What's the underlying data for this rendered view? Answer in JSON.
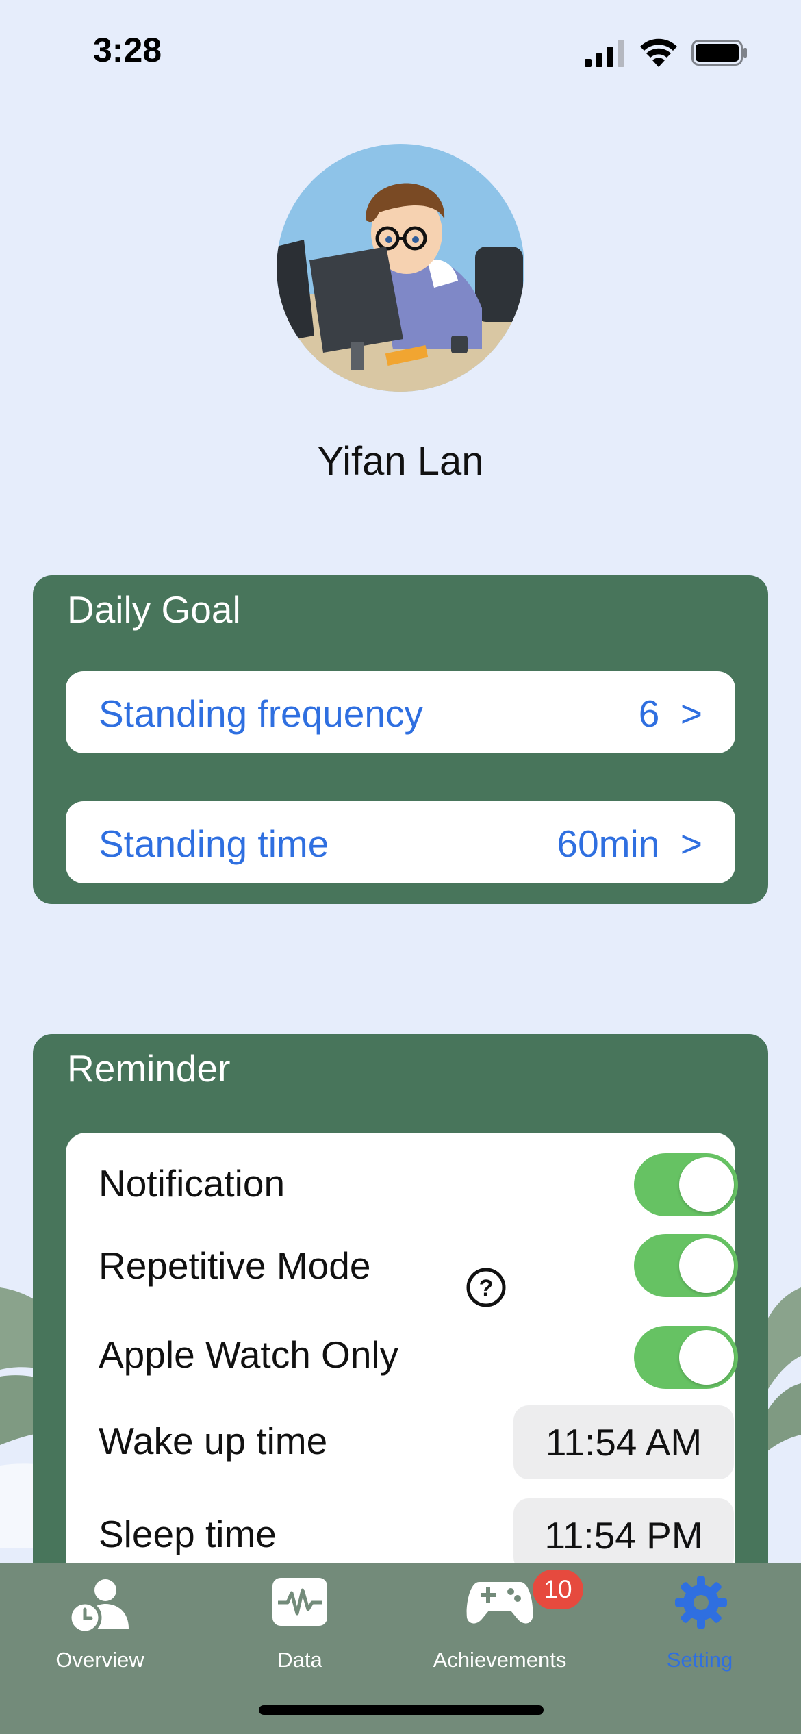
{
  "status_bar": {
    "time": "3:28"
  },
  "profile": {
    "name": "Yifan Lan"
  },
  "daily_goal": {
    "title": "Daily Goal",
    "items": [
      {
        "label": "Standing frequency",
        "value": "6",
        "chevron": ">"
      },
      {
        "label": "Standing time",
        "value": "60min",
        "chevron": ">"
      }
    ]
  },
  "reminder": {
    "title": "Reminder",
    "toggles": [
      {
        "label": "Notification",
        "on": true
      },
      {
        "label": "Repetitive Mode",
        "on": true,
        "icon": "question-circle-icon"
      },
      {
        "label": "Apple Watch Only",
        "on": true
      }
    ],
    "times": [
      {
        "label": "Wake up time",
        "value": "11:54 AM"
      },
      {
        "label": "Sleep time",
        "value": "11:54 PM"
      }
    ]
  },
  "tab_bar": {
    "tabs": [
      {
        "label": "Overview",
        "icon": "person-clock-icon"
      },
      {
        "label": "Data",
        "icon": "waveform-icon"
      },
      {
        "label": "Achievements",
        "icon": "gamecontroller-icon",
        "badge": "10"
      },
      {
        "label": "Setting",
        "icon": "gear-icon",
        "selected": true
      }
    ]
  },
  "colors": {
    "accent": "#2f6fe0",
    "card": "#48755b",
    "toggle_on": "#66c263",
    "background": "#e6edfb",
    "tab_bar": "#738b7a",
    "badge": "#e64a3e"
  }
}
